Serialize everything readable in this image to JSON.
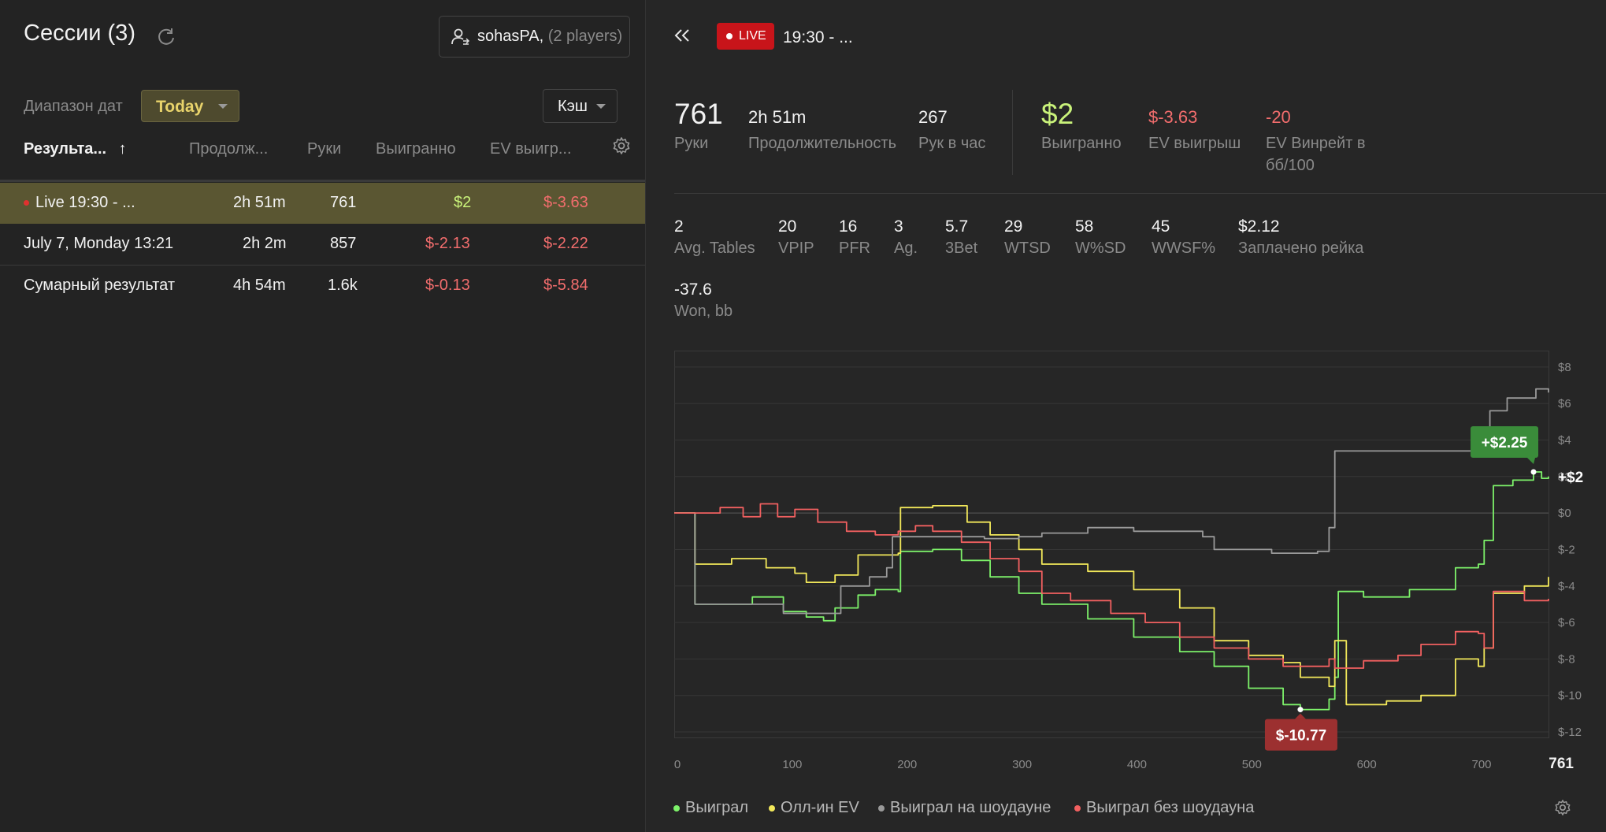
{
  "left": {
    "title": "Сессии (3)",
    "player": {
      "name": "sohasPA",
      "count": "(2 players)"
    },
    "date_range_label": "Диапазон дат",
    "date_range_value": "Today",
    "game_type": "Кэш",
    "columns": [
      "Результа...",
      "Продолж...",
      "Руки",
      "Выигранно",
      "EV выигр..."
    ],
    "sort_arrow": "↑",
    "rows": [
      {
        "name": "Live 19:30 - ...",
        "duration": "2h 51m",
        "hands": "761",
        "won": "$2",
        "ev": "$-3.63"
      },
      {
        "name": "July 7, Monday 13:21",
        "duration": "2h 2m",
        "hands": "857",
        "won": "$-2.13",
        "ev": "$-2.22"
      },
      {
        "name": "Сумарный результат",
        "duration": "4h 54m",
        "hands": "1.6k",
        "won": "$-0.13",
        "ev": "$-5.84"
      }
    ]
  },
  "right": {
    "live_label": "LIVE",
    "session_title": "19:30 - ...",
    "summary": {
      "hands": {
        "value": "761",
        "label": "Руки"
      },
      "duration": {
        "value": "2h 51m",
        "label": "Продолжительность"
      },
      "hands_per_hour": {
        "value": "267",
        "label": "Рук в час"
      },
      "won": {
        "value": "$2",
        "label": "Выигранно"
      },
      "ev_won": {
        "value": "$-3.63",
        "label": "EV выигрыш"
      },
      "ev_winrate": {
        "value": "-20",
        "label1": "EV Винрейт в",
        "label2": "бб/100"
      }
    },
    "stats": [
      {
        "value": "2",
        "label": "Avg. Tables"
      },
      {
        "value": "20",
        "label": "VPIP"
      },
      {
        "value": "16",
        "label": "PFR"
      },
      {
        "value": "3",
        "label": "Ag."
      },
      {
        "value": "5.7",
        "label": "3Bet"
      },
      {
        "value": "29",
        "label": "WTSD"
      },
      {
        "value": "58",
        "label": "W%SD"
      },
      {
        "value": "45",
        "label": "WWSF%"
      },
      {
        "value": "$2.12",
        "label": "Заплачено рейка"
      }
    ],
    "won_bb": {
      "value": "-37.6",
      "label": "Won, bb"
    },
    "legend": [
      "Выиграл",
      "Олл-ин EV",
      "Выиграл на шоудауне",
      "Выиграл без шоудауна"
    ]
  },
  "colors": {
    "green": "#7df26a",
    "yellow": "#f2e85a",
    "gray": "#9a9a9a",
    "red": "#f26060",
    "accent": "#e8d36b",
    "live": "#c8141a"
  },
  "chart_data": {
    "type": "line",
    "x_ticks": [
      "0",
      "100",
      "200",
      "300",
      "400",
      "500",
      "600",
      "700",
      "761"
    ],
    "y_ticks": [
      "$8",
      "$6",
      "$4",
      "$2",
      "$0",
      "$-2",
      "$-4",
      "$-6",
      "$-8",
      "$-10",
      "$-12"
    ],
    "xlim": [
      0,
      761
    ],
    "ylim": [
      -12,
      8
    ],
    "max_label": "+$2.25",
    "min_label": "$-10.77",
    "end_label": "+$2",
    "series": [
      {
        "name": "Выиграл",
        "color": "#7df26a",
        "points": [
          [
            0,
            0
          ],
          [
            15,
            0
          ],
          [
            18,
            -5
          ],
          [
            60,
            -5
          ],
          [
            68,
            -4.6
          ],
          [
            95,
            -5.4
          ],
          [
            115,
            -5.7
          ],
          [
            130,
            -5.9
          ],
          [
            140,
            -5.2
          ],
          [
            160,
            -4.5
          ],
          [
            175,
            -4.2
          ],
          [
            195,
            -4.3
          ],
          [
            197,
            -2.1
          ],
          [
            225,
            -2.0
          ],
          [
            250,
            -2.6
          ],
          [
            275,
            -3.5
          ],
          [
            300,
            -4.4
          ],
          [
            320,
            -5.0
          ],
          [
            360,
            -5.8
          ],
          [
            400,
            -6.8
          ],
          [
            440,
            -7.6
          ],
          [
            470,
            -8.4
          ],
          [
            500,
            -9.6
          ],
          [
            530,
            -10.5
          ],
          [
            545,
            -10.77
          ],
          [
            570,
            -10.2
          ],
          [
            575,
            -9.0
          ],
          [
            578,
            -4.3
          ],
          [
            600,
            -4.6
          ],
          [
            640,
            -4.2
          ],
          [
            680,
            -3.0
          ],
          [
            700,
            -2.8
          ],
          [
            705,
            -1.5
          ],
          [
            713,
            1.5
          ],
          [
            730,
            1.8
          ],
          [
            748,
            2.25
          ],
          [
            755,
            1.9
          ],
          [
            761,
            2
          ]
        ]
      },
      {
        "name": "Олл-ин EV",
        "color": "#f2e85a",
        "points": [
          [
            0,
            0
          ],
          [
            15,
            0
          ],
          [
            18,
            -2.8
          ],
          [
            50,
            -2.5
          ],
          [
            80,
            -3.0
          ],
          [
            105,
            -3.3
          ],
          [
            115,
            -3.8
          ],
          [
            140,
            -3.4
          ],
          [
            160,
            -2.3
          ],
          [
            195,
            -2.2
          ],
          [
            197,
            0.3
          ],
          [
            225,
            0.4
          ],
          [
            255,
            -0.5
          ],
          [
            275,
            -1.2
          ],
          [
            300,
            -2.0
          ],
          [
            320,
            -2.8
          ],
          [
            360,
            -3.2
          ],
          [
            400,
            -4.2
          ],
          [
            440,
            -5.2
          ],
          [
            470,
            -7.0
          ],
          [
            500,
            -7.8
          ],
          [
            530,
            -8.2
          ],
          [
            545,
            -9.0
          ],
          [
            570,
            -9.5
          ],
          [
            575,
            -7.0
          ],
          [
            585,
            -10.5
          ],
          [
            620,
            -10.3
          ],
          [
            650,
            -10.0
          ],
          [
            680,
            -8.0
          ],
          [
            700,
            -8.4
          ],
          [
            705,
            -7.4
          ],
          [
            713,
            -4.4
          ],
          [
            740,
            -4.0
          ],
          [
            761,
            -3.5
          ]
        ]
      },
      {
        "name": "Выиграл на шоудауне",
        "color": "#9a9a9a",
        "points": [
          [
            0,
            0
          ],
          [
            15,
            0
          ],
          [
            18,
            -5
          ],
          [
            90,
            -5
          ],
          [
            95,
            -5.5
          ],
          [
            140,
            -5.5
          ],
          [
            145,
            -4.0
          ],
          [
            170,
            -3.5
          ],
          [
            185,
            -3.0
          ],
          [
            190,
            -1.3
          ],
          [
            230,
            -1.3
          ],
          [
            270,
            -1.4
          ],
          [
            300,
            -1.3
          ],
          [
            320,
            -1.1
          ],
          [
            360,
            -0.8
          ],
          [
            400,
            -1.0
          ],
          [
            460,
            -1.3
          ],
          [
            470,
            -2.0
          ],
          [
            520,
            -2.2
          ],
          [
            560,
            -2.1
          ],
          [
            570,
            -0.8
          ],
          [
            575,
            3.4
          ],
          [
            620,
            3.4
          ],
          [
            690,
            3.4
          ],
          [
            700,
            3.5
          ],
          [
            710,
            5.6
          ],
          [
            725,
            6.3
          ],
          [
            750,
            6.8
          ],
          [
            761,
            6.6
          ]
        ]
      },
      {
        "name": "Выиграл без шоудауна",
        "color": "#f26060",
        "points": [
          [
            0,
            0
          ],
          [
            15,
            0
          ],
          [
            40,
            0.3
          ],
          [
            60,
            -0.2
          ],
          [
            75,
            0.5
          ],
          [
            90,
            -0.2
          ],
          [
            105,
            0.2
          ],
          [
            125,
            -0.5
          ],
          [
            150,
            -1.0
          ],
          [
            175,
            -1.2
          ],
          [
            195,
            -1.0
          ],
          [
            210,
            -0.7
          ],
          [
            225,
            -1.0
          ],
          [
            250,
            -1.6
          ],
          [
            275,
            -2.5
          ],
          [
            300,
            -3.2
          ],
          [
            320,
            -4.4
          ],
          [
            345,
            -4.8
          ],
          [
            380,
            -5.5
          ],
          [
            410,
            -6.0
          ],
          [
            440,
            -6.8
          ],
          [
            470,
            -7.4
          ],
          [
            500,
            -8.0
          ],
          [
            530,
            -8.4
          ],
          [
            545,
            -8.4
          ],
          [
            570,
            -8.0
          ],
          [
            575,
            -8.5
          ],
          [
            600,
            -8.1
          ],
          [
            630,
            -7.8
          ],
          [
            650,
            -7.2
          ],
          [
            680,
            -6.5
          ],
          [
            700,
            -6.6
          ],
          [
            705,
            -7.4
          ],
          [
            713,
            -4.3
          ],
          [
            740,
            -4.8
          ],
          [
            761,
            -4.7
          ]
        ]
      }
    ]
  }
}
